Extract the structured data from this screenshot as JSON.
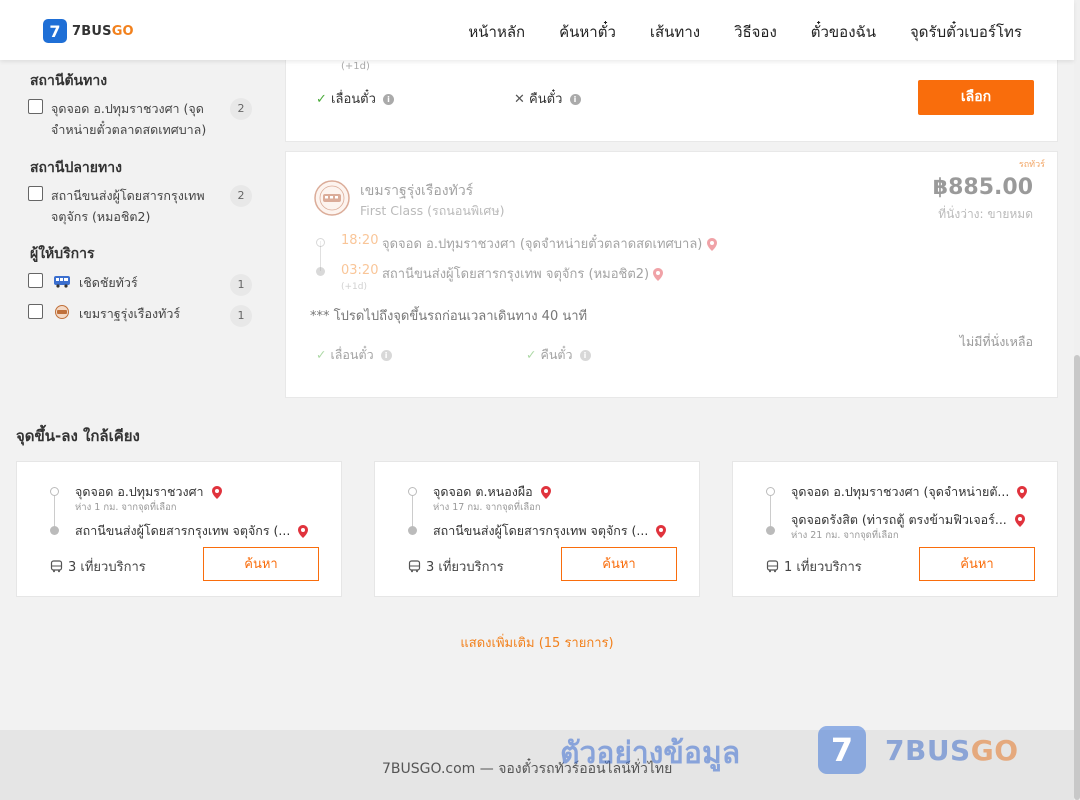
{
  "brand": {
    "logo_mark": "7",
    "name_prefix": "7BUS",
    "name_suffix": "GO"
  },
  "nav": [
    "หน้าหลัก",
    "ค้นหาตั๋ว",
    "เส้นทาง",
    "วิธีจอง",
    "ตั๋วของฉัน",
    "จุดรับตั๋วเบอร์โทร"
  ],
  "sidebar": {
    "origin_title": "สถานีต้นทาง",
    "origin_items": [
      {
        "label": "จุดจอด อ.ปทุมราชวงศา (จุดจำหน่ายตั๋วตลาดสดเทศบาล)",
        "count": "2"
      }
    ],
    "dest_title": "สถานีปลายทาง",
    "dest_items": [
      {
        "label": "สถานีขนส่งผู้โดยสารกรุงเทพ จตุจักร (หมอชิต2)",
        "count": "2"
      }
    ],
    "operator_title": "ผู้ให้บริการ",
    "operators": [
      {
        "label": "เชิดชัยทัวร์",
        "count": "1"
      },
      {
        "label": "เขมราฐรุ่งเรืองทัวร์",
        "count": "1"
      }
    ]
  },
  "card1": {
    "arrival_day": "(+1d)",
    "reschedule": "เลื่อนตั๋ว",
    "refund": "คืนตั๋ว",
    "select_button": "เลือก"
  },
  "card2": {
    "badge": "รถทัวร์",
    "operator": "เขมราฐรุ่งเรืองทัวร์",
    "bus_class": "First Class (รถนอนพิเศษ)",
    "price": "฿885.00",
    "seats": "ที่นั่งว่าง: ขายหมด",
    "depart_time": "18:20",
    "depart_station": "จุดจอด อ.ปทุมราชวงศา (จุดจำหน่ายตั๋วตลาดสดเทศบาล)",
    "arrive_time": "03:20",
    "arrive_station": "สถานีขนส่งผู้โดยสารกรุงเทพ จตุจักร (หมอชิต2)",
    "arrival_day": "(+1d)",
    "notice": "*** โปรดไปถึงจุดขึ้นรถก่อนเวลาเดินทาง 40 นาที",
    "reschedule": "เลื่อนตั๋ว",
    "refund": "คืนตั๋ว",
    "sold_out": "ไม่มีที่นั่งเหลือ"
  },
  "nearby": {
    "title": "จุดขึ้น-ลง ใกล้เคียง",
    "cards": [
      {
        "from": "จุดจอด อ.ปทุมราชวงศา",
        "from_dist": "ห่าง 1 กม. จากจุดที่เลือก",
        "to": "สถานีขนส่งผู้โดยสารกรุงเทพ จตุจักร (...",
        "to_dist": "",
        "trips": "3 เที่ยวบริการ",
        "button": "ค้นหา"
      },
      {
        "from": "จุดจอด ต.หนองผือ",
        "from_dist": "ห่าง 17 กม. จากจุดที่เลือก",
        "to": "สถานีขนส่งผู้โดยสารกรุงเทพ จตุจักร (...",
        "to_dist": "",
        "trips": "3 เที่ยวบริการ",
        "button": "ค้นหา"
      },
      {
        "from": "จุดจอด อ.ปทุมราชวงศา (จุดจำหน่ายตั...",
        "from_dist": "",
        "to": "จุดจอดรังสิต (ท่ารถตู้ ตรงข้ามฟิวเจอร์...",
        "to_dist": "ห่าง 21 กม. จากจุดที่เลือก",
        "trips": "1 เที่ยวบริการ",
        "button": "ค้นหา"
      }
    ],
    "show_more": "แสดงเพิ่มเติม (15 รายการ)"
  },
  "footer": {
    "text": "7BUSGO.com — จองตั๋วรถทัวร์ออนไลน์ทั่วไทย",
    "watermark_text": "ตัวอย่างข้อมูล",
    "watermark_mark": "7",
    "watermark_prefix": "7BUS",
    "watermark_suffix": "GO"
  },
  "colors": {
    "accent": "#f96d0c",
    "brand_blue": "#1f6fd6",
    "check_green": "#4aab3a",
    "pin_red": "#e0333d"
  }
}
